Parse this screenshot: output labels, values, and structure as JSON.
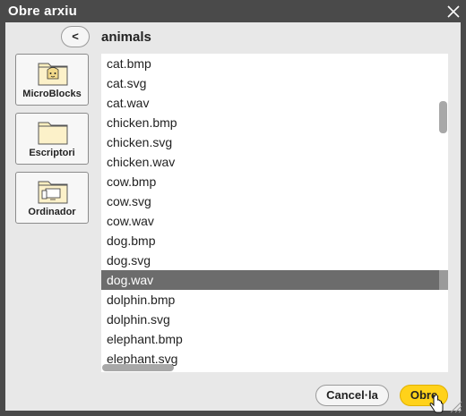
{
  "window": {
    "title": "Obre arxiu"
  },
  "nav": {
    "back_label": "<",
    "folder_name": "animals"
  },
  "shortcuts": [
    {
      "label": "MicroBlocks",
      "icon": "microblocks-folder-icon"
    },
    {
      "label": "Escriptori",
      "icon": "folder-icon"
    },
    {
      "label": "Ordinador",
      "icon": "computer-folder-icon"
    }
  ],
  "files": [
    "cat.bmp",
    "cat.svg",
    "cat.wav",
    "chicken.bmp",
    "chicken.svg",
    "chicken.wav",
    "cow.bmp",
    "cow.svg",
    "cow.wav",
    "dog.bmp",
    "dog.svg",
    "dog.wav",
    "dolphin.bmp",
    "dolphin.svg",
    "elephant.bmp",
    "elephant.svg"
  ],
  "selected_file": "dog.wav",
  "buttons": {
    "cancel_label": "Cancel·la",
    "open_label": "Obre"
  },
  "colors": {
    "accent": "#ffd21a",
    "selection": "#6c6c6c",
    "chrome": "#4a4a4a"
  }
}
